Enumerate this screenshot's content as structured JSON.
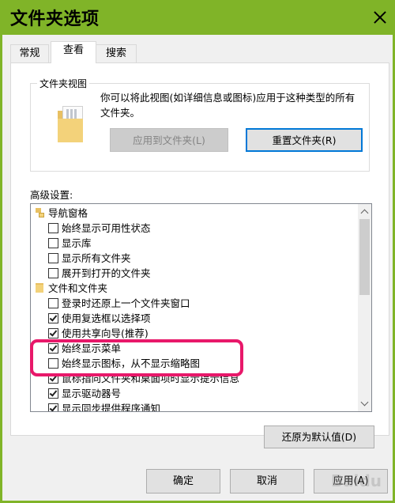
{
  "window": {
    "title": "文件夹选项"
  },
  "tabs": [
    {
      "label": "常规"
    },
    {
      "label": "查看"
    },
    {
      "label": "搜索"
    }
  ],
  "folder_views": {
    "group_label": "文件夹视图",
    "description": "你可以将此视图(如详细信息或图标)应用于这种类型的所有文件夹。",
    "apply_button": "应用到文件夹(L)",
    "reset_button": "重置文件夹(R)"
  },
  "advanced": {
    "label": "高级设置:",
    "items": [
      {
        "type": "category",
        "icon": "navigation-pane-icon",
        "label": "导航窗格"
      },
      {
        "type": "checkbox",
        "checked": false,
        "label": "始终显示可用性状态"
      },
      {
        "type": "checkbox",
        "checked": false,
        "label": "显示库"
      },
      {
        "type": "checkbox",
        "checked": false,
        "label": "显示所有文件夹"
      },
      {
        "type": "checkbox",
        "checked": false,
        "label": "展开到打开的文件夹"
      },
      {
        "type": "category",
        "icon": "folder-icon",
        "label": "文件和文件夹"
      },
      {
        "type": "checkbox",
        "checked": false,
        "label": "登录时还原上一个文件夹窗口"
      },
      {
        "type": "checkbox",
        "checked": true,
        "label": "使用复选框以选择项"
      },
      {
        "type": "checkbox",
        "checked": true,
        "label": "使用共享向导(推荐)"
      },
      {
        "type": "checkbox",
        "checked": true,
        "label": "始终显示菜单"
      },
      {
        "type": "checkbox",
        "checked": false,
        "label": "始终显示图标，从不显示缩略图"
      },
      {
        "type": "checkbox",
        "checked": true,
        "label": "鼠标指向文件夹和桌面项时显示提示信息"
      },
      {
        "type": "checkbox",
        "checked": true,
        "label": "显示驱动器号"
      },
      {
        "type": "checkbox",
        "checked": true,
        "label": "显示同步提供程序通知"
      }
    ],
    "restore_defaults_button": "还原为默认值(D)"
  },
  "footer": {
    "ok_button": "确定",
    "cancel_button": "取消",
    "apply_button": "应用(A)"
  },
  "watermark": "Baidu",
  "colors": {
    "titlebar": "#80b428",
    "highlight_ring": "#e8186a",
    "focus_border": "#0078d7"
  }
}
